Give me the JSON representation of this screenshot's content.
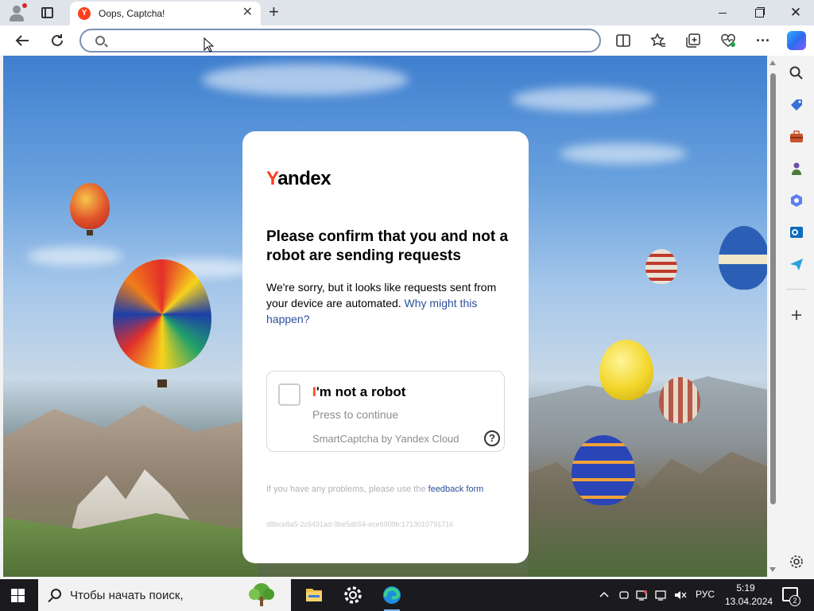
{
  "browser": {
    "tab": {
      "title": "Oops, Captcha!",
      "favicon_letter": "Y",
      "favicon_color": "#fc3f1d"
    },
    "address_bar": {
      "value": "",
      "placeholder": ""
    },
    "toolbar_icons": [
      "back-icon",
      "refresh-icon",
      "split-screen-icon",
      "favorites-icon",
      "collections-icon",
      "browser-essentials-icon",
      "more-icon",
      "copilot-icon"
    ],
    "sidebar_icons": [
      "search-icon",
      "shopping-icon",
      "tools-icon",
      "games-icon",
      "microsoft-365-icon",
      "outlook-icon",
      "drop-icon",
      "add-icon",
      "settings-icon"
    ]
  },
  "captcha": {
    "logo": {
      "first": "Y",
      "rest": "andex"
    },
    "headline": "Please confirm that you and not a robot are sending requests",
    "description": "We're sorry, but it looks like requests sent from your device are automated.",
    "why_link": "Why might this happen?",
    "checkbox": {
      "label_first": "I",
      "label_rest": "'m not a robot",
      "subtitle": "Press to continue",
      "brand": "SmartCaptcha by Yandex Cloud",
      "checked": false
    },
    "help_symbol": "?",
    "problem_text": "If you have any problems, please use the",
    "feedback_link": "feedback form",
    "request_id": "d8bce8a5-2c5491ad-9be5d654-ece6909b:1713010791716",
    "accent_color": "#fc3f1d",
    "link_color": "#2b4f9a"
  },
  "taskbar": {
    "search_placeholder": "Чтобы начать поиск,",
    "apps": [
      "file-explorer-icon",
      "settings-icon",
      "edge-icon"
    ],
    "language": "РУС",
    "time": "5:19",
    "date": "13.04.2024",
    "notification_count": "2"
  }
}
